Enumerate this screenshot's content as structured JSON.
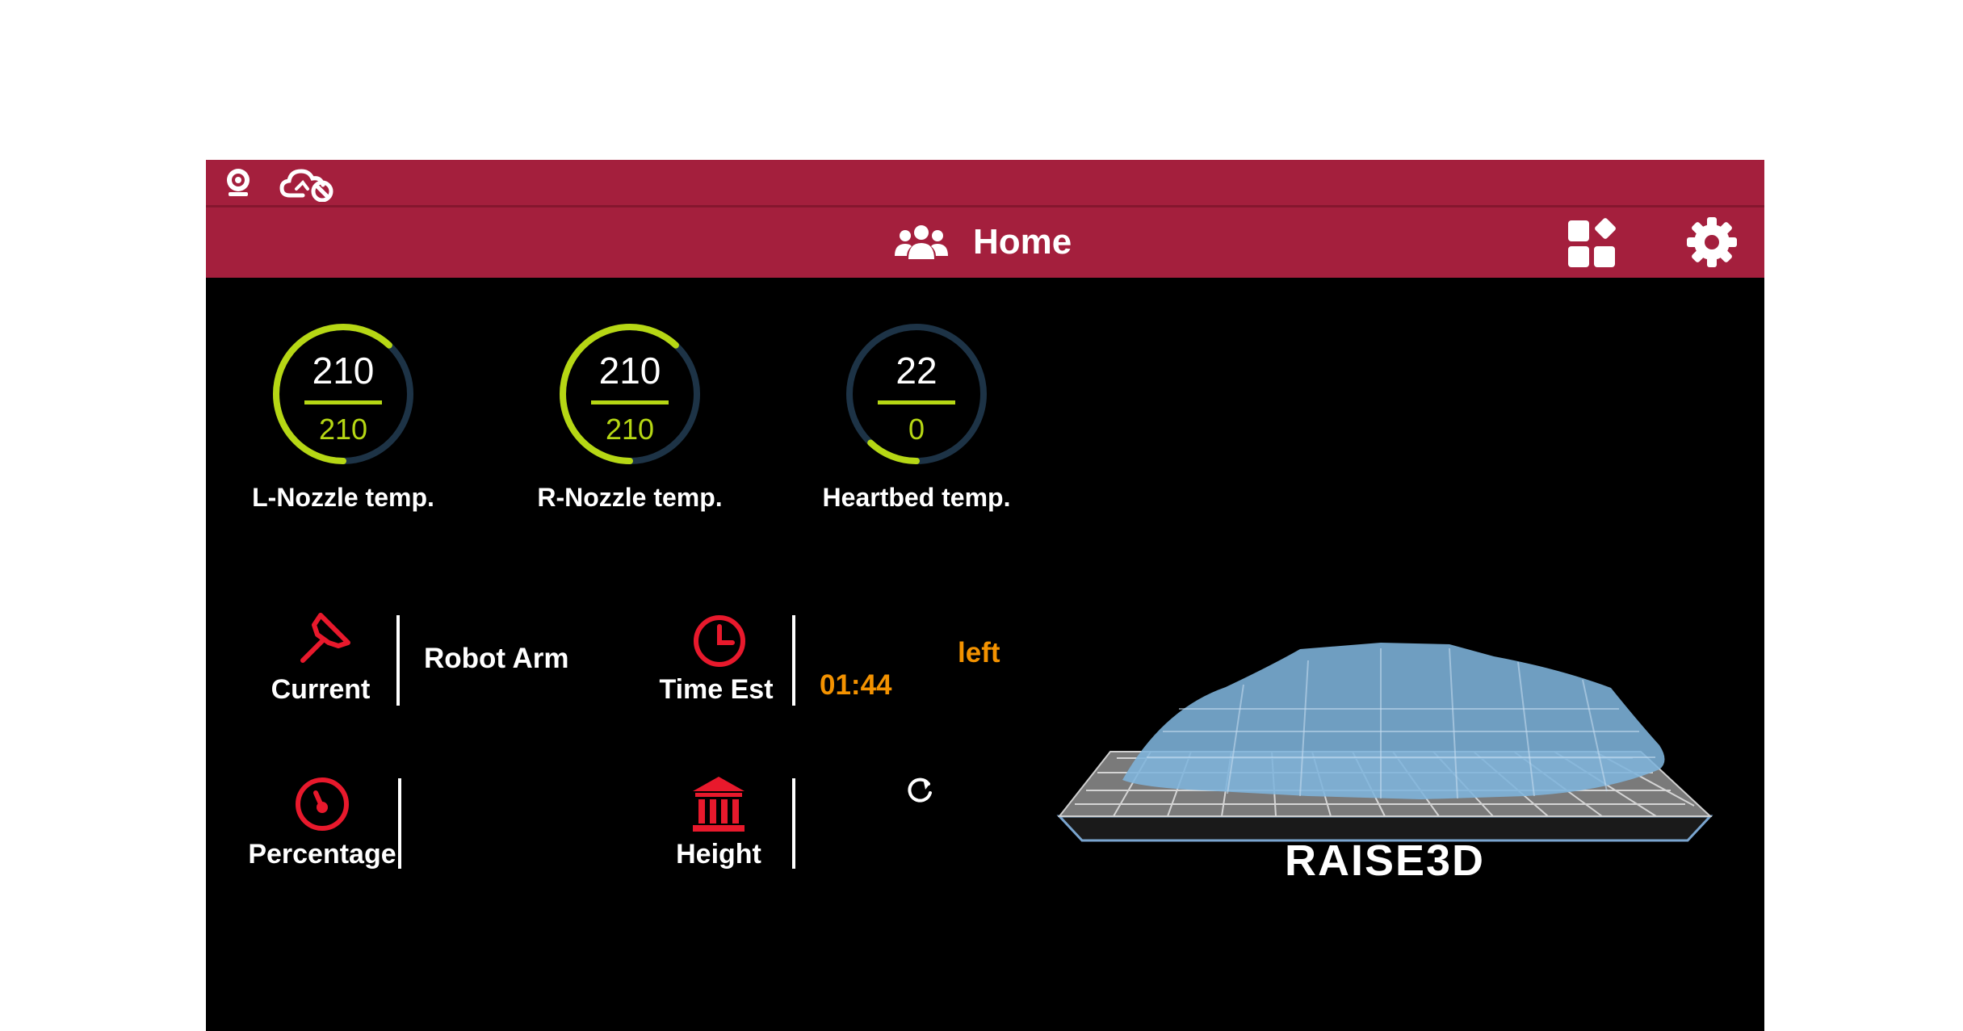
{
  "status_bar": {
    "icons": [
      "webcam-icon",
      "cloud-disconnected-icon"
    ]
  },
  "header": {
    "title": "Home",
    "title_icon": "users-icon",
    "right_icons": [
      "apps-icon",
      "gear-icon"
    ]
  },
  "gauges": [
    {
      "label": "L-Nozzle temp.",
      "current": "210",
      "target": "210",
      "fraction": 0.62
    },
    {
      "label": "R-Nozzle temp.",
      "current": "210",
      "target": "210",
      "fraction": 0.62
    },
    {
      "label": "Heartbed temp.",
      "current": "22",
      "target": "0",
      "fraction": 0.12
    }
  ],
  "info": {
    "current_label": "Current",
    "current_value": "Robot Arm",
    "time_est_label": "Time Est",
    "time_left_label": "left",
    "time_value": "01:44",
    "percentage_label": "Percentage",
    "height_label": "Height",
    "refresh_icon": "refresh-icon"
  },
  "preview": {
    "brand": "RAISE3D"
  },
  "colors": {
    "header_bg": "#a41f3d",
    "gauge_active": "#b6d714",
    "gauge_track": "#1d3346",
    "icon_red": "#e8192c",
    "accent_orange": "#f39200"
  }
}
